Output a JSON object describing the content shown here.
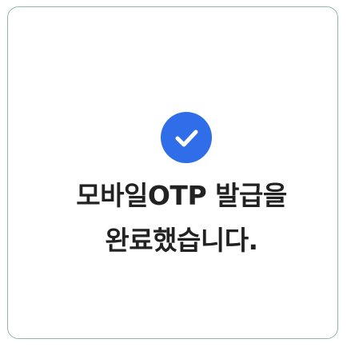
{
  "colors": {
    "accent": "#2f6ee8",
    "text": "#222222",
    "card_border": "#8fb8a4"
  },
  "icon": {
    "name": "check-circle-icon"
  },
  "message": {
    "line1": "모바일OTP 발급을",
    "line2": "완료했습니다."
  }
}
